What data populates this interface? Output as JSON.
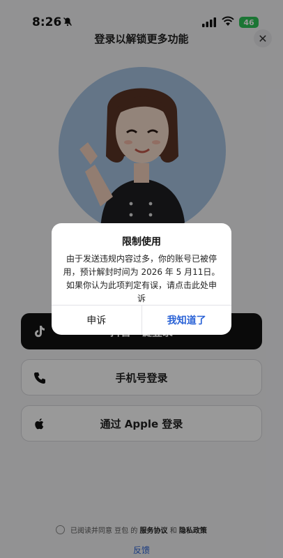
{
  "status_bar": {
    "time": "8:26",
    "battery": "46"
  },
  "header": {
    "title": "登录以解锁更多功能",
    "close_symbol": "✕"
  },
  "login": {
    "douyin_label": "抖音一键登录",
    "phone_label": "手机号登录",
    "apple_label": "通过 Apple 登录"
  },
  "agreement": {
    "prefix": "已阅读并同意 豆包 的",
    "service": "服务协议",
    "and": "和",
    "privacy": "隐私政策"
  },
  "feedback": "反馈",
  "dialog": {
    "title": "限制使用",
    "message": "由于发送违规内容过多，你的账号已被停用，预计解封时间为 2026 年 5 月11日。如果你认为此项判定有误，请点击此处申诉",
    "appeal_label": "申诉",
    "ok_label": "我知道了"
  },
  "colors": {
    "accent": "#2a62d6",
    "battery": "#2ec458",
    "avatar_bg": "#a7c3e2"
  }
}
